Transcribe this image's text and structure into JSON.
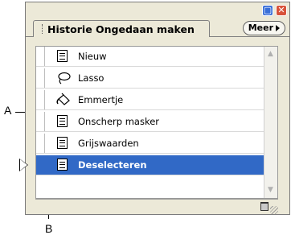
{
  "callouts": {
    "a": "A",
    "b": "B"
  },
  "palette": {
    "tab_title": "Historie Ongedaan maken",
    "menu_button": "Meer",
    "history_items": [
      {
        "label": "Nieuw",
        "icon": "document-icon",
        "selected": false
      },
      {
        "label": "Lasso",
        "icon": "lasso-icon",
        "selected": false
      },
      {
        "label": "Emmertje",
        "icon": "paint-bucket-icon",
        "selected": false
      },
      {
        "label": "Onscherp masker",
        "icon": "document-icon",
        "selected": false
      },
      {
        "label": "Grijswaarden",
        "icon": "document-icon",
        "selected": false
      },
      {
        "label": "Deselecteren",
        "icon": "document-icon",
        "selected": true
      }
    ]
  },
  "colors": {
    "selection": "#3169c6",
    "panel": "#ece9d8"
  }
}
